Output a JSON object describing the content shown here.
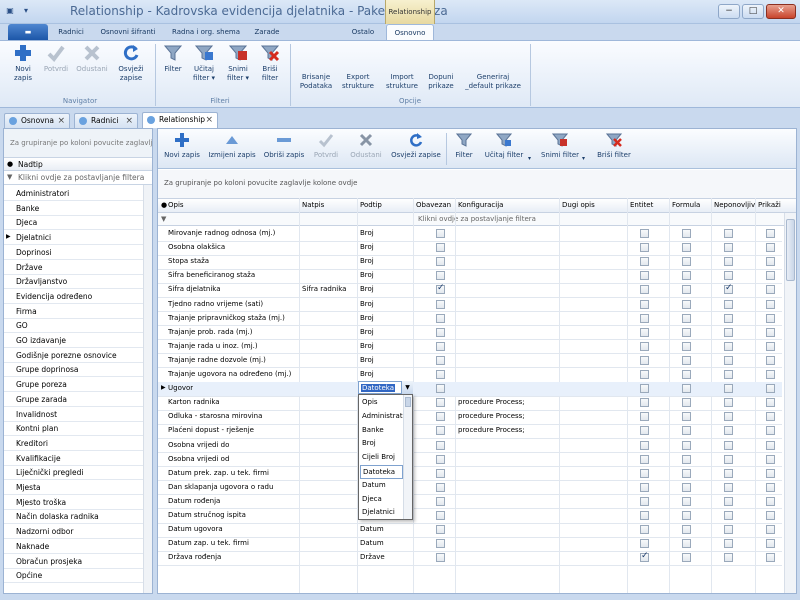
{
  "window": {
    "title": "Relationship - Kadrovska evidencija djelatnika - Pakel test baza",
    "context_tab_header": "Relationship",
    "controls": [
      "−",
      "□",
      "✕"
    ]
  },
  "ribbon_tabs": [
    "Radnici",
    "Osnovni šifranti",
    "Radna i org. shema",
    "Zarade",
    "Ostalo",
    "Osnovno"
  ],
  "ribbon": {
    "navigator": {
      "label": "Navigator",
      "buttons": [
        {
          "label": "Novi\nzapis",
          "icon": "plus-icon",
          "enabled": true
        },
        {
          "label": "Potvrdi",
          "icon": "check-icon",
          "enabled": false
        },
        {
          "label": "Odustani",
          "icon": "x-icon",
          "enabled": false
        },
        {
          "label": "Osvježi\nzapise",
          "icon": "refresh-icon",
          "enabled": true
        }
      ]
    },
    "filteri": {
      "label": "Filteri",
      "buttons": [
        {
          "label": "Filter",
          "icon": "funnel-icon"
        },
        {
          "label": "Učitaj\nfilter ▾",
          "icon": "load-filter-icon"
        },
        {
          "label": "Snimi\nfilter ▾",
          "icon": "save-filter-icon"
        },
        {
          "label": "Briši\nfilter",
          "icon": "delete-filter-icon"
        }
      ]
    },
    "opcije": {
      "label": "Opcije",
      "buttons": [
        {
          "label": "Brisanje\nPodataka"
        },
        {
          "label": "Export\nstrukture"
        },
        {
          "label": "Import\nstrukture"
        },
        {
          "label": "Dopuni\nprikaze"
        },
        {
          "label": "Generiraj\n_default prikaze"
        }
      ]
    }
  },
  "doc_tabs": [
    {
      "label": "Osnovna",
      "active": false
    },
    {
      "label": "Radnici",
      "active": false
    },
    {
      "label": "Relationship",
      "active": true
    }
  ],
  "left_panel": {
    "group_hint": "Za grupiranje po koloni povucite zaglavlje",
    "column_header": "Nadtip",
    "filter_hint": "Klikni ovdje za postavljanje filtera",
    "items": [
      "Administratori",
      "Banke",
      "Djeca",
      "Djelatnici",
      "Doprinosi",
      "Države",
      "Državljanstvo",
      "Evidencija određeno",
      "Firma",
      "GO",
      "GO izdavanje",
      "Godišnje porezne osnovice",
      "Grupe doprinosa",
      "Grupe poreza",
      "Grupe zarada",
      "Invalidnost",
      "Kontni plan",
      "Kreditori",
      "Kvalifikacije",
      "Liječnički pregledi",
      "Mjesta",
      "Mjesto troška",
      "Način dolaska radnika",
      "Nadzorni odbor",
      "Naknade",
      "Obračun prosjeka",
      "Općine"
    ],
    "current_index": 3
  },
  "toolbar": [
    {
      "label": "Novi zapis",
      "icon": "plus-icon",
      "enabled": true
    },
    {
      "label": "Izmijeni zapis",
      "icon": "edit-icon",
      "enabled": true
    },
    {
      "label": "Obriši zapis",
      "icon": "minus-icon",
      "enabled": true
    },
    {
      "label": "Potvrdi",
      "icon": "check-icon",
      "enabled": false
    },
    {
      "label": "Odustani",
      "icon": "x-icon",
      "enabled": false
    },
    {
      "label": "Osvježi zapise",
      "icon": "refresh-icon",
      "enabled": true
    },
    {
      "label": "Filter",
      "icon": "funnel-icon",
      "enabled": true
    },
    {
      "label": "Učitaj filter",
      "icon": "load-filter-icon",
      "enabled": true
    },
    {
      "label": "Snimi filter",
      "icon": "save-filter-icon",
      "enabled": true
    },
    {
      "label": "Briši filter",
      "icon": "delete-filter-icon",
      "enabled": true
    }
  ],
  "grid": {
    "group_hint": "Za grupiranje po koloni povucite zaglavlje kolone ovdje",
    "filter_hint": "Klikni ovdje za postavljanje filtera",
    "columns": [
      "Opis",
      "Natpis",
      "Podtip",
      "Obavezan",
      "Konfiguracija",
      "Dugi opis",
      "Entitet",
      "Formula",
      "Neponovljiv",
      "Prikaži"
    ],
    "rows": [
      {
        "opis": "Mirovanje radnog odnosa (mj.)",
        "natpis": "",
        "podtip": "Broj",
        "obavezan": false,
        "konfiguracija": "",
        "neponovljiv": false
      },
      {
        "opis": "Osobna olakšica",
        "natpis": "",
        "podtip": "Broj",
        "obavezan": false,
        "konfiguracija": "",
        "neponovljiv": false
      },
      {
        "opis": "Stopa staža",
        "natpis": "",
        "podtip": "Broj",
        "obavezan": false,
        "konfiguracija": "",
        "neponovljiv": false
      },
      {
        "opis": "Šifra beneficiranog staža",
        "natpis": "",
        "podtip": "Broj",
        "obavezan": false,
        "konfiguracija": "",
        "neponovljiv": false
      },
      {
        "opis": "Šifra djelatnika",
        "natpis": "Šifra radnika",
        "podtip": "Broj",
        "obavezan": true,
        "konfiguracija": "",
        "neponovljiv": true
      },
      {
        "opis": "Tjedno radno vrijeme (sati)",
        "natpis": "",
        "podtip": "Broj",
        "obavezan": false,
        "konfiguracija": "",
        "neponovljiv": false
      },
      {
        "opis": "Trajanje pripravničkog staža (mj.)",
        "natpis": "",
        "podtip": "Broj",
        "obavezan": false,
        "konfiguracija": "",
        "neponovljiv": false
      },
      {
        "opis": "Trajanje prob. rada (mj.)",
        "natpis": "",
        "podtip": "Broj",
        "obavezan": false,
        "konfiguracija": "",
        "neponovljiv": false
      },
      {
        "opis": "Trajanje rada u inoz. (mj.)",
        "natpis": "",
        "podtip": "Broj",
        "obavezan": false,
        "konfiguracija": "",
        "neponovljiv": false
      },
      {
        "opis": "Trajanje radne dozvole (mj.)",
        "natpis": "",
        "podtip": "Broj",
        "obavezan": false,
        "konfiguracija": "",
        "neponovljiv": false
      },
      {
        "opis": "Trajanje ugovora na određeno (mj.)",
        "natpis": "",
        "podtip": "Broj",
        "obavezan": false,
        "konfiguracija": "",
        "neponovljiv": false
      },
      {
        "opis": "Ugovor",
        "natpis": "",
        "podtip": "Datoteka",
        "obavezan": false,
        "konfiguracija": "",
        "neponovljiv": false
      },
      {
        "opis": "Karton radnika",
        "natpis": "",
        "podtip": "",
        "obavezan": false,
        "konfiguracija": "procedure Process;",
        "neponovljiv": false
      },
      {
        "opis": "Odluka - starosna mirovina",
        "natpis": "",
        "podtip": "",
        "obavezan": false,
        "konfiguracija": "procedure Process;",
        "neponovljiv": false
      },
      {
        "opis": "Plaćeni dopust - rješenje",
        "natpis": "",
        "podtip": "",
        "obavezan": false,
        "konfiguracija": "procedure Process;",
        "neponovljiv": false
      },
      {
        "opis": "Osobna vrijedi do",
        "natpis": "",
        "podtip": "",
        "obavezan": false,
        "konfiguracija": "",
        "neponovljiv": false
      },
      {
        "opis": "Osobna vrijedi od",
        "natpis": "",
        "podtip": "",
        "obavezan": false,
        "konfiguracija": "",
        "neponovljiv": false
      },
      {
        "opis": "Datum prek. zap. u tek. firmi",
        "natpis": "",
        "podtip": "",
        "obavezan": false,
        "konfiguracija": "",
        "neponovljiv": false
      },
      {
        "opis": "Dan sklapanja ugovora o radu",
        "natpis": "",
        "podtip": "",
        "obavezan": false,
        "konfiguracija": "",
        "neponovljiv": false
      },
      {
        "opis": "Datum rođenja",
        "natpis": "",
        "podtip": "",
        "obavezan": false,
        "konfiguracija": "",
        "neponovljiv": false
      },
      {
        "opis": "Datum stručnog ispita",
        "natpis": "",
        "podtip": "",
        "obavezan": false,
        "konfiguracija": "",
        "neponovljiv": false
      },
      {
        "opis": "Datum ugovora",
        "natpis": "",
        "podtip": "Datum",
        "obavezan": false,
        "konfiguracija": "",
        "neponovljiv": false
      },
      {
        "opis": "Datum zap. u tek. firmi",
        "natpis": "",
        "podtip": "Datum",
        "obavezan": false,
        "konfiguracija": "",
        "neponovljiv": false
      },
      {
        "opis": "Država rođenja",
        "natpis": "",
        "podtip": "Države",
        "obavezan": false,
        "konfiguracija": "",
        "neponovljiv": false
      }
    ],
    "selected_row": 11,
    "entitet_checked_row": 23
  },
  "dropdown": {
    "value": "Datoteka",
    "options": [
      "Opis",
      "Administrat",
      "Banke",
      "Broj",
      "Cijeli Broj",
      "Datoteka",
      "Datum",
      "Djeca",
      "Djelatnici"
    ],
    "highlighted": "Datoteka"
  },
  "colors": {
    "accent": "#1c56a8",
    "window_bg": "#c9d9ee",
    "selection": "#e8f0fb"
  }
}
